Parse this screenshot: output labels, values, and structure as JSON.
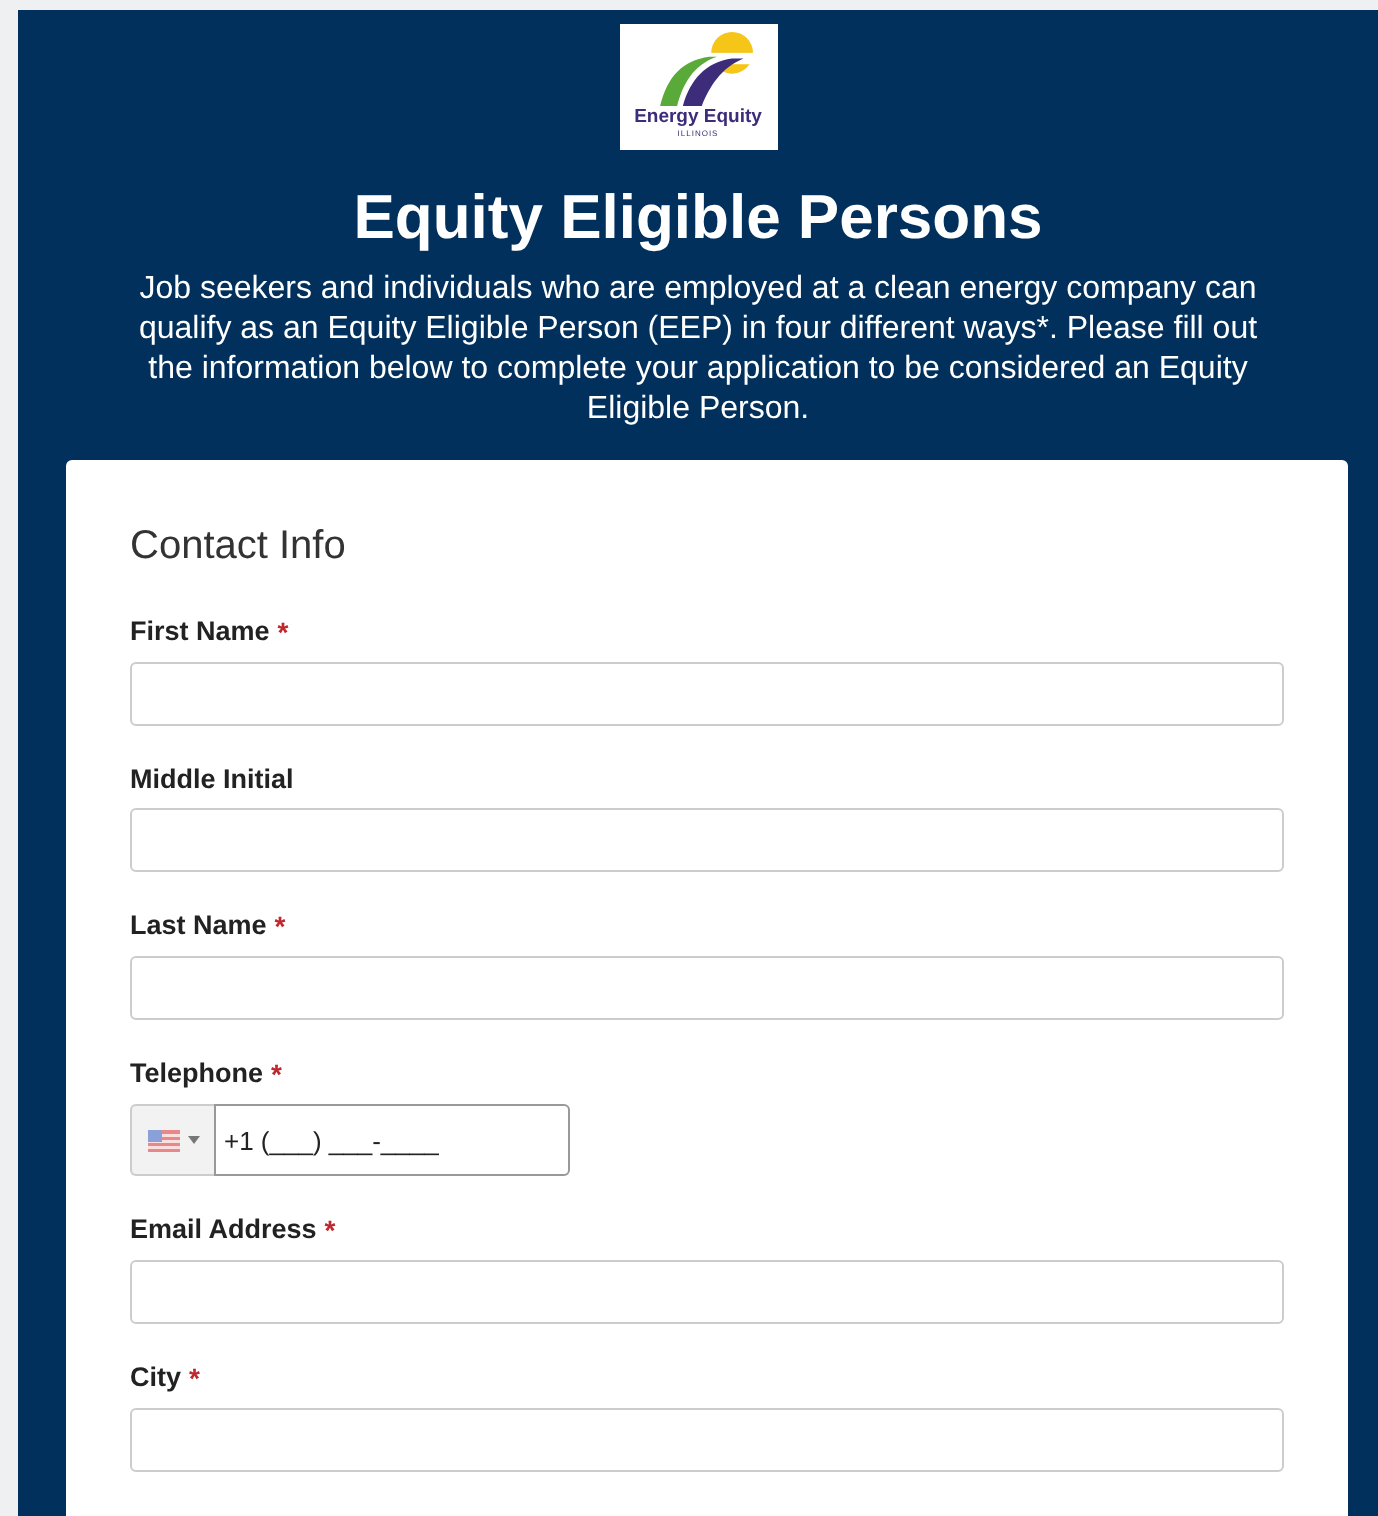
{
  "logo": {
    "name": "Energy Equity",
    "region": "ILLINOIS"
  },
  "title": "Equity Eligible Persons",
  "intro": "Job seekers and individuals who are employed at a clean energy company can qualify as an Equity Eligible Person (EEP) in four different ways*. Please fill out the information below to complete your application to be considered an Equity Eligible Person.",
  "section": "Contact Info",
  "required_marker": "*",
  "fields": [
    {
      "label": "First Name",
      "required": true,
      "kind": "text"
    },
    {
      "label": "Middle Initial",
      "required": false,
      "kind": "text"
    },
    {
      "label": "Last Name",
      "required": true,
      "kind": "text"
    },
    {
      "label": "Telephone",
      "required": true,
      "kind": "phone",
      "placeholder": "+1 (___) ___-____"
    },
    {
      "label": "Email Address",
      "required": true,
      "kind": "text"
    },
    {
      "label": "City",
      "required": true,
      "kind": "text"
    }
  ]
}
